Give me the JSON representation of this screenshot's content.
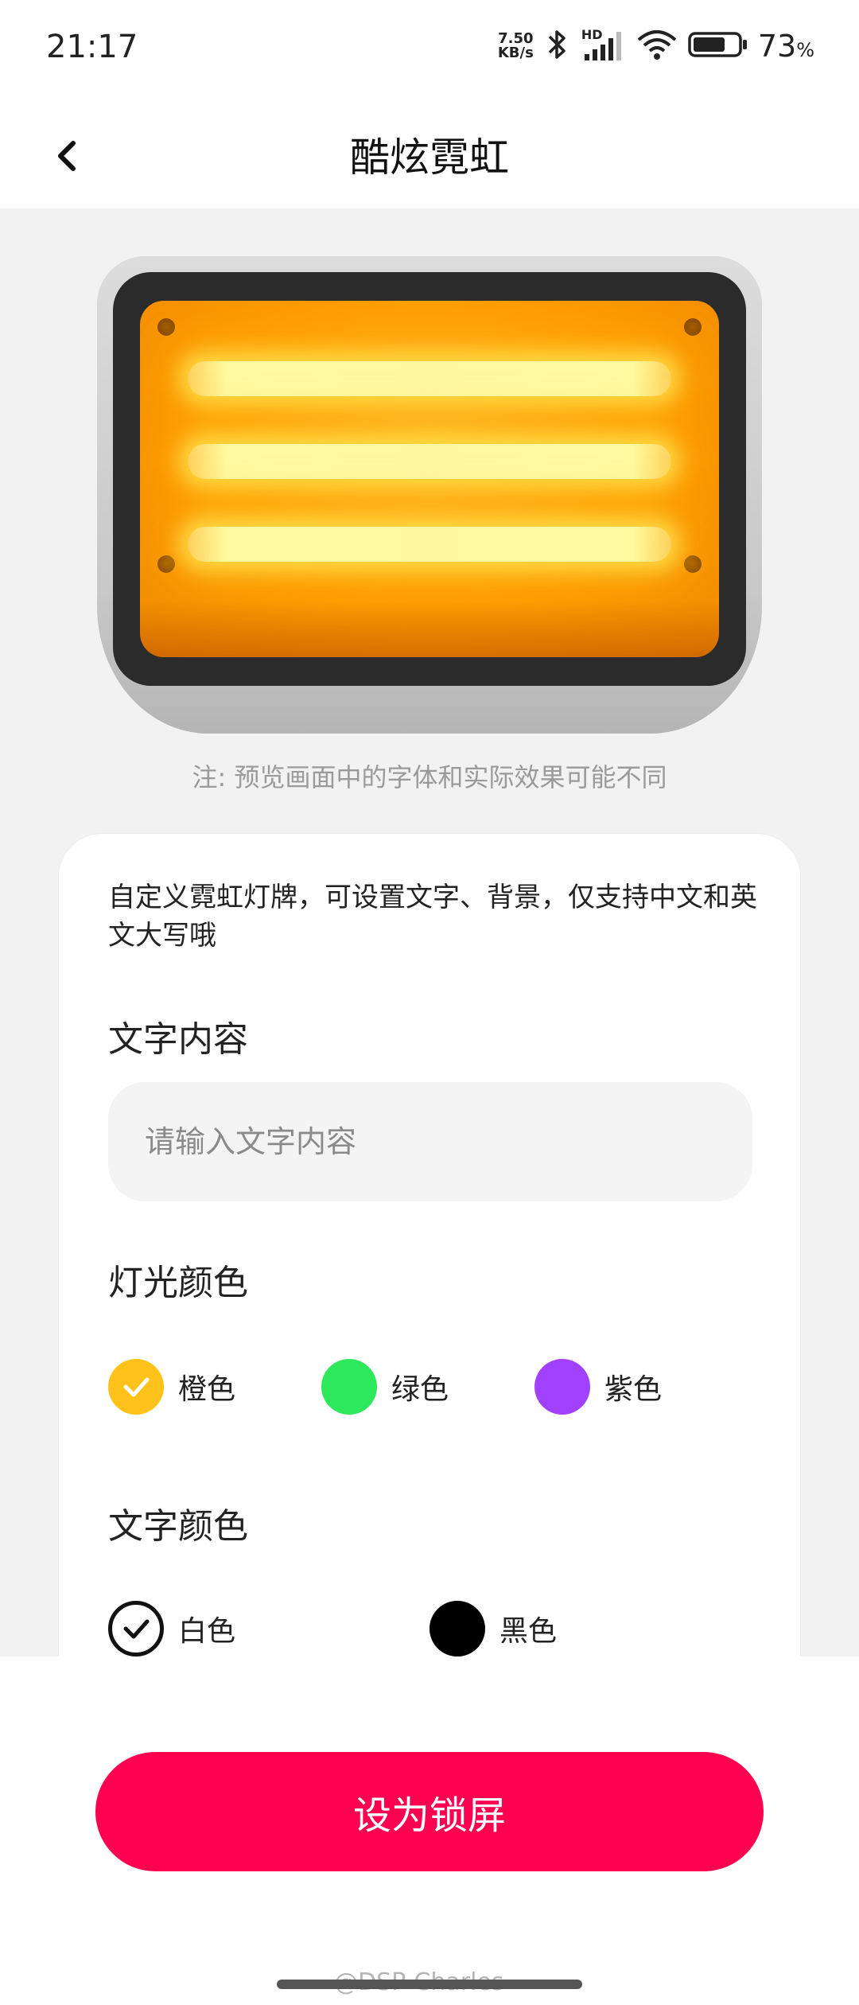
{
  "status_bar": {
    "time": "21:17",
    "net_speed_value": "7.50",
    "net_speed_unit": "KB/s",
    "hd_label": "HD",
    "battery_percent": "73",
    "battery_unit": "%",
    "battery_level": 0.73,
    "icons": [
      "bluetooth-icon",
      "signal-icon",
      "wifi-icon",
      "battery-icon"
    ]
  },
  "header": {
    "title": "酷炫霓虹",
    "back_icon": "chevron-left-icon"
  },
  "preview": {
    "note": "注: 预览画面中的字体和实际效果可能不同",
    "light_color": "#ff9a00",
    "neon_line_count": 3
  },
  "settings": {
    "description": "自定义霓虹灯牌，可设置文字、背景，仅支持中文和英文大写哦",
    "text_section_title": "文字内容",
    "text_input_placeholder": "请输入文字内容",
    "text_input_value": "",
    "light_color_title": "灯光颜色",
    "light_colors": [
      {
        "label": "橙色",
        "color": "#ffc21a",
        "selected": true
      },
      {
        "label": "绿色",
        "color": "#2ee85c",
        "selected": false
      },
      {
        "label": "紫色",
        "color": "#a140ff",
        "selected": false
      }
    ],
    "text_color_title": "文字颜色",
    "text_colors": [
      {
        "label": "白色",
        "color": "#ffffff",
        "selected": true
      },
      {
        "label": "黑色",
        "color": "#000000",
        "selected": false
      }
    ]
  },
  "actions": {
    "set_lockscreen_label": "设为锁屏"
  },
  "watermark": "@DSP-Charles"
}
